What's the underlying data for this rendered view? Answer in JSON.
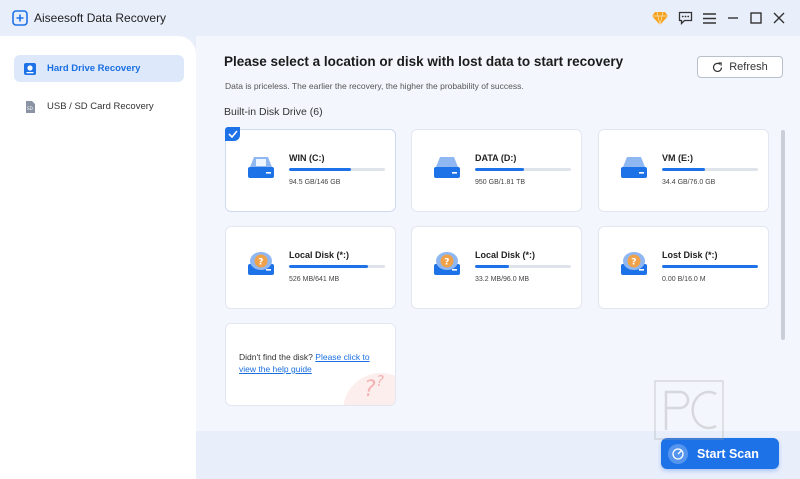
{
  "app": {
    "title": "Aiseesoft Data Recovery"
  },
  "titlebar_icons": [
    "premium-diamond-icon",
    "feedback-chat-icon",
    "menu-icon",
    "minimize-icon",
    "maximize-icon",
    "close-icon"
  ],
  "sidebar": {
    "items": [
      {
        "label": "Hard Drive Recovery",
        "icon": "hard-drive-icon",
        "active": true
      },
      {
        "label": "USB / SD Card Recovery",
        "icon": "sd-card-icon",
        "active": false
      }
    ]
  },
  "main": {
    "headline": "Please select a location or disk with lost data to start recovery",
    "subline": "Data is priceless. The earlier the recovery, the higher the probability of success.",
    "refresh_label": "Refresh",
    "section_label": "Built-in Disk Drive (6)",
    "disks": [
      {
        "name": "WIN (C:)",
        "size": "94.5 GB/146 GB",
        "used_fraction": 0.647,
        "type": "system",
        "selected": true
      },
      {
        "name": "DATA (D:)",
        "size": "950 GB/1.81 TB",
        "used_fraction": 0.51,
        "type": "normal",
        "selected": false
      },
      {
        "name": "VM (E:)",
        "size": "34.4 GB/76.0 GB",
        "used_fraction": 0.45,
        "type": "normal",
        "selected": false
      },
      {
        "name": "Local Disk (*:)",
        "size": "526 MB/641 MB",
        "used_fraction": 0.82,
        "type": "unknown",
        "selected": false
      },
      {
        "name": "Local Disk (*:)",
        "size": "33.2 MB/96.0 MB",
        "used_fraction": 0.35,
        "type": "unknown",
        "selected": false
      },
      {
        "name": "Lost Disk (*:)",
        "size": "0.00  B/16.0 M",
        "used_fraction": 1.0,
        "type": "unknown",
        "selected": false
      }
    ],
    "help": {
      "prefix": "Didn't find the disk? ",
      "link": "Please click to view the help guide"
    }
  },
  "footer": {
    "start_scan_label": "Start Scan"
  },
  "colors": {
    "accent": "#1e72e8",
    "sidebar_active_bg": "#dde8fb",
    "unknown_disk_orange": "#f0a24a"
  }
}
